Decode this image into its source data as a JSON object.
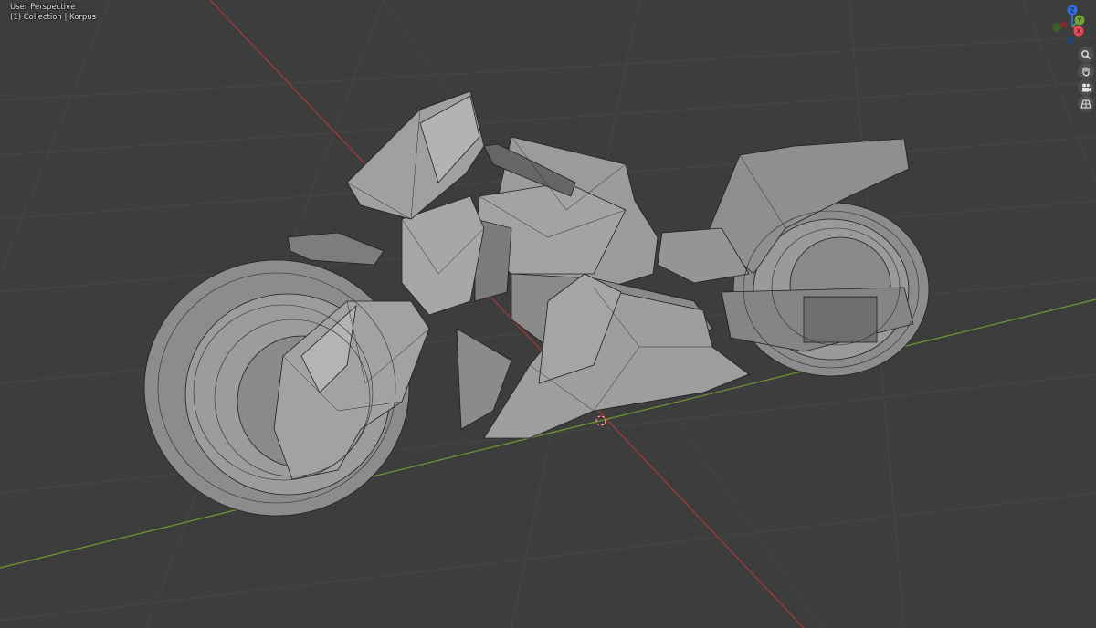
{
  "viewport": {
    "view_name": "User Perspective",
    "collection_label": "(1) Collection | Korpus"
  },
  "gizmo": {
    "z_label": "Z",
    "x_label": "X",
    "y_label": "Y",
    "colors": {
      "z": "#2f6fe0",
      "x": "#e8475a",
      "y": "#6fa33a",
      "y_neg": "#3f5d22"
    }
  },
  "nav_buttons": [
    {
      "name": "zoom-button",
      "icon": "magnifier-icon"
    },
    {
      "name": "pan-button",
      "icon": "hand-icon"
    },
    {
      "name": "camera-view-button",
      "icon": "camera-icon"
    },
    {
      "name": "toggle-perspective-button",
      "icon": "grid-icon"
    }
  ],
  "colors": {
    "background": "#3d3d3d",
    "grid": "#474747",
    "x_axis": "#a83a3a",
    "y_axis": "#6f9a33",
    "mesh_fill": "#8e8e8e",
    "mesh_wire": "#1e1e1e"
  }
}
